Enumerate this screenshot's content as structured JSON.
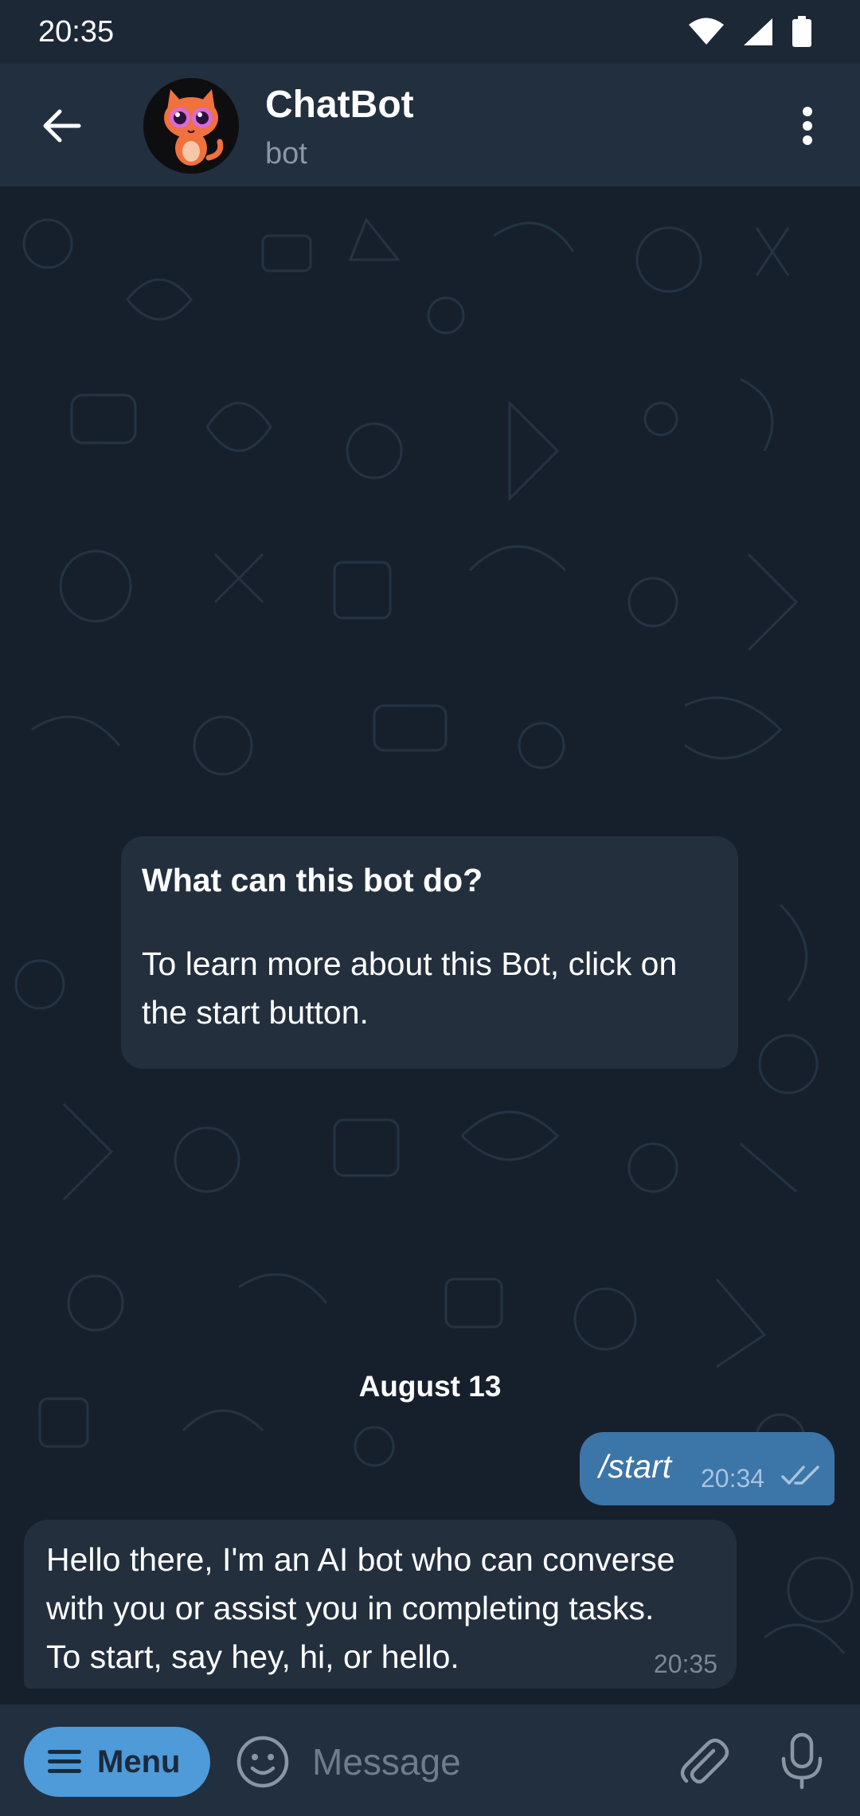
{
  "status_bar": {
    "time": "20:35"
  },
  "header": {
    "title": "ChatBot",
    "subtitle": "bot"
  },
  "info_card": {
    "title": "What can this bot do?",
    "body": "To learn more about this Bot, click on the start button."
  },
  "date_separator": "August 13",
  "messages": [
    {
      "direction": "outgoing",
      "text": "/start",
      "time": "20:34",
      "status": "read"
    },
    {
      "direction": "incoming",
      "text": "Hello there, I'm an AI bot who can converse\nwith you or assist you in completing tasks.\n To start, say hey, hi, or hello.",
      "time": "20:35"
    }
  ],
  "input_bar": {
    "menu_label": "Menu",
    "placeholder": "Message"
  },
  "colors": {
    "background": "#16202c",
    "header": "#222f3e",
    "outgoing_bubble": "#3c75a8",
    "incoming_bubble": "#232f3d",
    "menu_button": "#4f9ad8"
  },
  "icons": [
    "back-arrow-icon",
    "more-vert-icon",
    "wifi-icon",
    "signal-icon",
    "battery-icon",
    "double-check-icon",
    "menu-lines-icon",
    "emoji-icon",
    "paperclip-icon",
    "mic-icon"
  ]
}
